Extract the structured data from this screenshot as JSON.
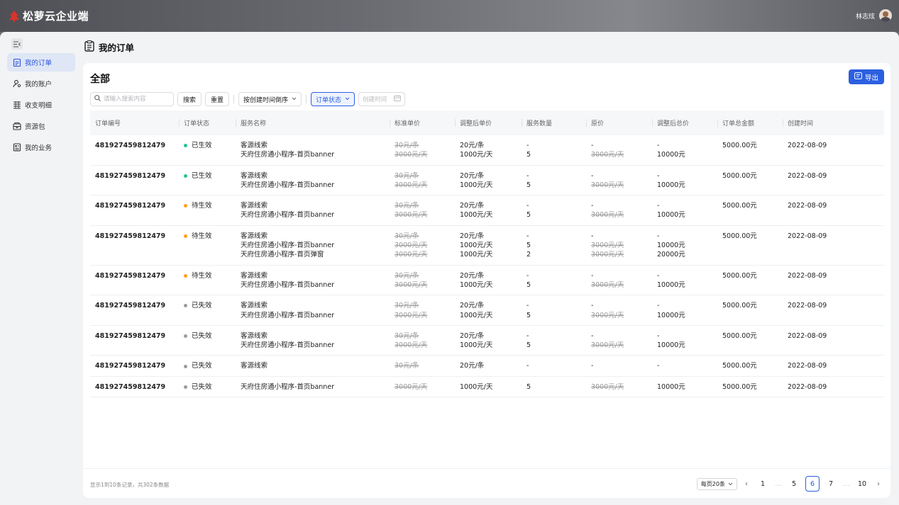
{
  "app": {
    "title": "松萝云企业端",
    "user_name": "林志炫"
  },
  "sidebar": {
    "items": [
      {
        "label": "我的订单",
        "icon": "order-icon",
        "active": true
      },
      {
        "label": "我的账户",
        "icon": "account-icon",
        "active": false
      },
      {
        "label": "收支明细",
        "icon": "ledger-icon",
        "active": false
      },
      {
        "label": "资源包",
        "icon": "package-icon",
        "active": false
      },
      {
        "label": "我的业务",
        "icon": "business-icon",
        "active": false
      }
    ]
  },
  "page": {
    "title": "我的订单"
  },
  "card": {
    "title": "全部",
    "export_label": "导出"
  },
  "filters": {
    "search_placeholder": "请输入搜索内容",
    "search_label": "搜索",
    "reset_label": "重置",
    "sort_label": "按创建时间倒序",
    "status_label": "订单状态",
    "date_placeholder": "创建时间"
  },
  "table": {
    "columns": [
      "订单编号",
      "订单状态",
      "服务名称",
      "标准单价",
      "调整后单价",
      "服务数量",
      "原价",
      "调整后总价",
      "订单总金额",
      "创建时间"
    ],
    "rows": [
      {
        "id": "481927459812479",
        "status": "已生效",
        "status_color": "green",
        "services": [
          "客源线索",
          "天府住房通小程序-首页banner"
        ],
        "std_price": [
          "30元/条",
          "3000元/天"
        ],
        "adj_price": [
          "20元/条",
          "1000元/天"
        ],
        "qty": [
          "-",
          "5"
        ],
        "orig": [
          "-",
          "3000元/天"
        ],
        "adj_total": [
          "-",
          "10000元"
        ],
        "total": "5000.00元",
        "created": "2022-08-09"
      },
      {
        "id": "481927459812479",
        "status": "已生效",
        "status_color": "green",
        "services": [
          "客源线索",
          "天府住房通小程序-首页banner"
        ],
        "std_price": [
          "30元/条",
          "3000元/天"
        ],
        "adj_price": [
          "20元/条",
          "1000元/天"
        ],
        "qty": [
          "-",
          "5"
        ],
        "orig": [
          "-",
          "3000元/天"
        ],
        "adj_total": [
          "-",
          "10000元"
        ],
        "total": "5000.00元",
        "created": "2022-08-09"
      },
      {
        "id": "481927459812479",
        "status": "待生效",
        "status_color": "orange",
        "services": [
          "客源线索",
          "天府住房通小程序-首页banner"
        ],
        "std_price": [
          "30元/条",
          "3000元/天"
        ],
        "adj_price": [
          "20元/条",
          "1000元/天"
        ],
        "qty": [
          "-",
          "5"
        ],
        "orig": [
          "-",
          "3000元/天"
        ],
        "adj_total": [
          "-",
          "10000元"
        ],
        "total": "5000.00元",
        "created": "2022-08-09"
      },
      {
        "id": "481927459812479",
        "status": "待生效",
        "status_color": "orange",
        "services": [
          "客源线索",
          "天府住房通小程序-首页banner",
          "天府住房通小程序-首页弹窗"
        ],
        "std_price": [
          "30元/条",
          "3000元/天",
          "3000元/天"
        ],
        "adj_price": [
          "20元/条",
          "1000元/天",
          "1000元/天"
        ],
        "qty": [
          "-",
          "5",
          "2"
        ],
        "orig": [
          "-",
          "3000元/天",
          "3000元/天"
        ],
        "adj_total": [
          "-",
          "10000元",
          "20000元"
        ],
        "total": "5000.00元",
        "created": "2022-08-09"
      },
      {
        "id": "481927459812479",
        "status": "待生效",
        "status_color": "orange",
        "services": [
          "客源线索",
          "天府住房通小程序-首页banner"
        ],
        "std_price": [
          "30元/条",
          "3000元/天"
        ],
        "adj_price": [
          "20元/条",
          "1000元/天"
        ],
        "qty": [
          "-",
          "5"
        ],
        "orig": [
          "-",
          "3000元/天"
        ],
        "adj_total": [
          "-",
          "10000元"
        ],
        "total": "5000.00元",
        "created": "2022-08-09"
      },
      {
        "id": "481927459812479",
        "status": "已失效",
        "status_color": "gray",
        "services": [
          "客源线索",
          "天府住房通小程序-首页banner"
        ],
        "std_price": [
          "30元/条",
          "3000元/天"
        ],
        "adj_price": [
          "20元/条",
          "1000元/天"
        ],
        "qty": [
          "-",
          "5"
        ],
        "orig": [
          "-",
          "3000元/天"
        ],
        "adj_total": [
          "-",
          "10000元"
        ],
        "total": "5000.00元",
        "created": "2022-08-09"
      },
      {
        "id": "481927459812479",
        "status": "已失效",
        "status_color": "gray",
        "services": [
          "客源线索",
          "天府住房通小程序-首页banner"
        ],
        "std_price": [
          "30元/条",
          "3000元/天"
        ],
        "adj_price": [
          "20元/条",
          "1000元/天"
        ],
        "qty": [
          "-",
          "5"
        ],
        "orig": [
          "-",
          "3000元/天"
        ],
        "adj_total": [
          "-",
          "10000元"
        ],
        "total": "5000.00元",
        "created": "2022-08-09"
      },
      {
        "id": "481927459812479",
        "status": "已失效",
        "status_color": "gray",
        "services": [
          "客源线索"
        ],
        "std_price": [
          "30元/条"
        ],
        "adj_price": [
          "20元/条"
        ],
        "qty": [
          "-"
        ],
        "orig": [
          "-"
        ],
        "adj_total": [
          "-"
        ],
        "total": "5000.00元",
        "created": "2022-08-09"
      },
      {
        "id": "481927459812479",
        "status": "已失效",
        "status_color": "gray",
        "services": [
          "天府住房通小程序-首页banner"
        ],
        "std_price": [
          "3000元/天"
        ],
        "adj_price": [
          "1000元/天"
        ],
        "qty": [
          "5"
        ],
        "orig": [
          "3000元/天"
        ],
        "adj_total": [
          "10000元"
        ],
        "total": "5000.00元",
        "created": "2022-08-09"
      }
    ]
  },
  "footer": {
    "summary": "显示1到10条记录，共302条数据",
    "page_size": "每页20条",
    "pages": [
      "1",
      "…",
      "5",
      "6",
      "7",
      "…",
      "10"
    ],
    "current_page": "6"
  },
  "colors": {
    "accent": "#2c5fe0",
    "active_green": "#23c29a",
    "pending_orange": "#ff9f1a",
    "expired_gray": "#9a9ba0"
  }
}
